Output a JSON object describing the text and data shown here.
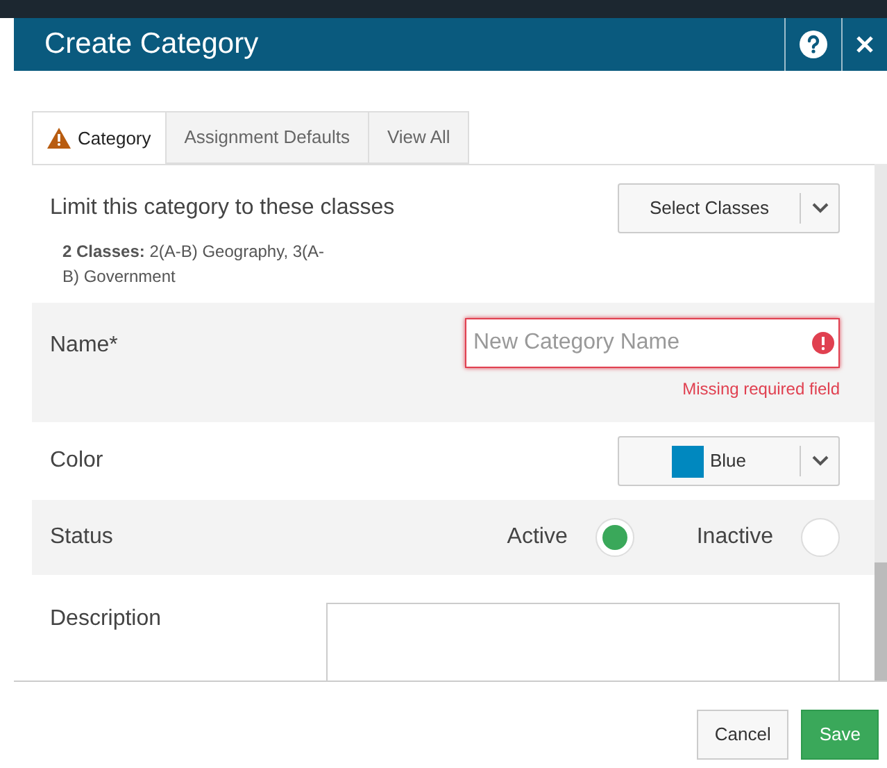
{
  "dialog": {
    "title": "Create Category"
  },
  "tabs": [
    {
      "label": "Category",
      "selected": true,
      "warning": true
    },
    {
      "label": "Assignment Defaults",
      "selected": false,
      "warning": false
    },
    {
      "label": "View All",
      "selected": false,
      "warning": false
    }
  ],
  "classes": {
    "label": "Limit this category to these classes",
    "button": "Select Classes",
    "summary": "**2 Classes:** 2(A-B) Geography, 3(A-B) Government"
  },
  "name": {
    "label": "Name*",
    "placeholder": "New Category Name",
    "invalid": true,
    "error": "Missing required field"
  },
  "color": {
    "label": "Color",
    "value": "Blue",
    "color": "#0088bf"
  },
  "status": {
    "label": "Status",
    "options": [
      {
        "label": "Active",
        "selected": true
      },
      {
        "label": "Inactive",
        "selected": false
      }
    ]
  },
  "description": {
    "label": "Description"
  },
  "buttons": [
    {
      "label": "Cancel",
      "kind": "secondary"
    },
    {
      "label": "Save",
      "kind": "primary"
    }
  ]
}
